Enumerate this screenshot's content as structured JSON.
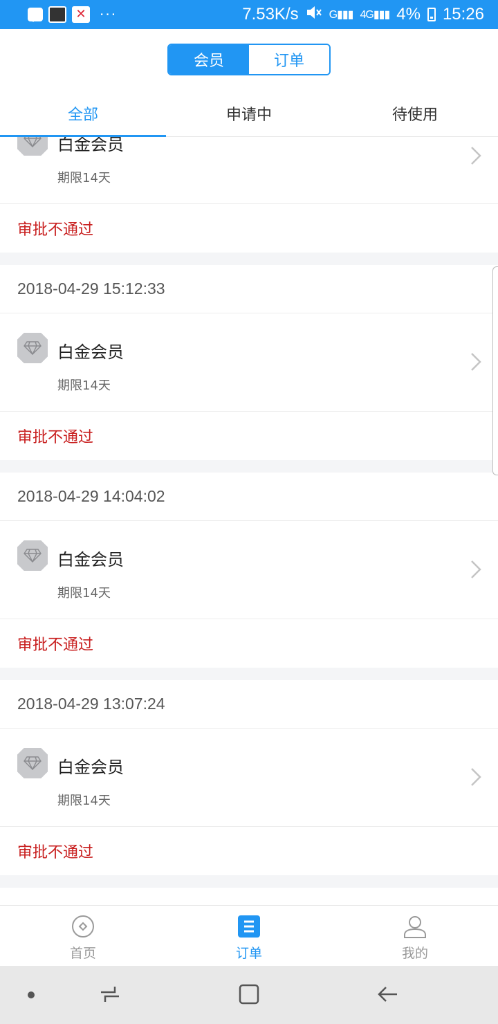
{
  "status_bar": {
    "net_speed": "7.53K/s",
    "signal1": "G",
    "signal2": "4G",
    "battery": "4%",
    "time": "15:26",
    "dots": "···"
  },
  "segment": {
    "member_label": "会员",
    "order_label": "订单"
  },
  "tabs": [
    {
      "label": "全部"
    },
    {
      "label": "申请中"
    },
    {
      "label": "待使用"
    }
  ],
  "orders": [
    {
      "date": "",
      "title": "白金会员",
      "duration": "期限14天",
      "status": "审批不通过"
    },
    {
      "date": "2018-04-29 15:12:33",
      "title": "白金会员",
      "duration": "期限14天",
      "status": "审批不通过"
    },
    {
      "date": "2018-04-29 14:04:02",
      "title": "白金会员",
      "duration": "期限14天",
      "status": "审批不通过"
    },
    {
      "date": "2018-04-29 13:07:24",
      "title": "白金会员",
      "duration": "期限14天",
      "status": "审批不通过"
    }
  ],
  "bottom_nav": [
    {
      "label": "首页",
      "icon": "home-icon"
    },
    {
      "label": "订单",
      "icon": "order-list-icon"
    },
    {
      "label": "我的",
      "icon": "user-icon"
    }
  ],
  "colors": {
    "accent": "#2196f3",
    "status_red": "#c81e1e",
    "badge_gray": "#c8c9cc"
  }
}
